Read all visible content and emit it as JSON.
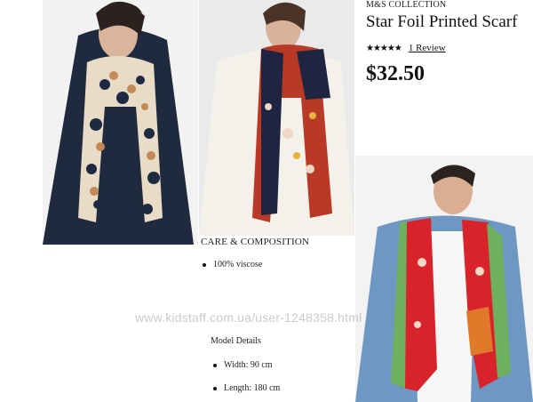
{
  "product": {
    "collection": "M&S COLLECTION",
    "title": "Star Foil Printed Scarf",
    "stars": "★★★★★",
    "review_link": "1 Review",
    "price": "$32.50"
  },
  "care": {
    "title": "CARE & COMPOSITION",
    "composition": "100% viscose"
  },
  "model_details": {
    "title": "Model Details",
    "items": [
      "Width: 90 cm",
      "Length: 180 cm"
    ]
  },
  "watermark": "www.kidstaff.com.ua/user-1248358.html",
  "colors": {
    "text": "#111111",
    "background": "#ffffff"
  }
}
